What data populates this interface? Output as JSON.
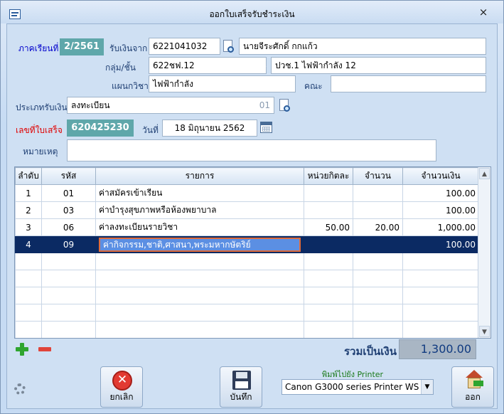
{
  "window": {
    "title": "ออกใบเสร็จรับชำระเงิน",
    "close_glyph": "×"
  },
  "form": {
    "term_label": "ภาคเรียนที่",
    "term_value": "2/2561",
    "receive_from_label": "รับเงินจาก",
    "student_id": "6221041032",
    "student_name": "นายจีระศักดิ์  กกแก้ว",
    "group_label": "กลุ่ม/ชั้น",
    "group_code": "622ชฟ.12",
    "group_name": "ปวช.1 ไฟฟ้ากำลัง 12",
    "department_label": "แผนกวิชา",
    "department_value": "ไฟฟ้ากำลัง",
    "faculty_label": "คณะ",
    "faculty_value": "",
    "payment_type_label": "ประเภทรับเงิน",
    "payment_type_value": "ลงทะเบียน",
    "payment_type_code": "01",
    "receipt_no_label": "เลขที่ใบเสร็จ",
    "receipt_no_value": "620425230",
    "date_label": "วันที่",
    "date_value": "18 มิถุนายน 2562",
    "note_label": "หมายเหตุ",
    "note_value": ""
  },
  "table": {
    "columns": [
      "ลำดับ",
      "รหัส",
      "รายการ",
      "หน่วยกิตละ",
      "จำนวน",
      "จำนวนเงิน"
    ],
    "rows": [
      {
        "no": "1",
        "code": "01",
        "item": "ค่าสมัครเข้าเรียน",
        "unit": "",
        "qty": "",
        "amount": "100.00"
      },
      {
        "no": "2",
        "code": "03",
        "item": "ค่าบำรุงสุขภาพหรือห้องพยาบาล",
        "unit": "",
        "qty": "",
        "amount": "100.00"
      },
      {
        "no": "3",
        "code": "06",
        "item": "ค่าลงทะเบียนรายวิชา",
        "unit": "50.00",
        "qty": "20.00",
        "amount": "1,000.00"
      },
      {
        "no": "4",
        "code": "09",
        "item": "ค่ากิจกรรม,ชาติ,ศาสนา,พระมหากษัตริย์",
        "unit": "",
        "qty": "",
        "amount": "100.00"
      }
    ]
  },
  "summary": {
    "total_label": "รวมเป็นเงิน",
    "total_value": "1,300.00"
  },
  "actions": {
    "cancel_label": "ยกเลิก",
    "save_label": "บันทึก",
    "exit_label": "ออก"
  },
  "printer": {
    "label": "พิมพ์ไปยัง Printer",
    "selected": "Canon G3000 series Printer WS"
  },
  "colors": {
    "accent_teal": "#5fa7aa",
    "selected_row": "#0b2a63",
    "receipt_label_red": "#e00000"
  },
  "icons": [
    "app-icon",
    "close-icon",
    "lookup-icon",
    "calendar-icon",
    "add-icon",
    "remove-icon",
    "cancel-icon",
    "save-icon",
    "exit-icon",
    "settings-icon"
  ]
}
